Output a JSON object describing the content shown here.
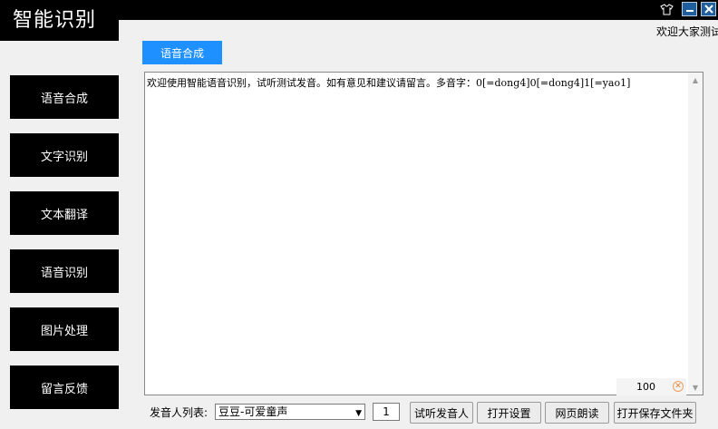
{
  "app": {
    "title": "智能识别",
    "welcome": "欢迎大家测试"
  },
  "window_buttons": {
    "skin": "shirt-icon",
    "minimize": "—",
    "close": "✕"
  },
  "sidebar": {
    "items": [
      {
        "label": "语音合成"
      },
      {
        "label": "文字识别"
      },
      {
        "label": "文本翻译"
      },
      {
        "label": "语音识别"
      },
      {
        "label": "图片处理"
      },
      {
        "label": "留言反馈"
      }
    ]
  },
  "tabs": {
    "active": "语音合成"
  },
  "editor": {
    "text": "欢迎使用智能语音识别，试听测试发音。如有意见和建议请留言。多音字：0[=dong4]0[=dong4]1[=yao1]"
  },
  "zoom": {
    "value": "100"
  },
  "bottom": {
    "voice_label": "发音人列表:",
    "voice_selected": "豆豆-可爱童声",
    "speed_value": "1",
    "buttons": {
      "preview": "试听发音人",
      "settings": "打开设置",
      "web_read": "网页朗读",
      "open_folder": "打开保存文件夹"
    }
  },
  "colors": {
    "accent": "#1e90ff",
    "panel": "#000000",
    "background": "#f0f0f0"
  }
}
